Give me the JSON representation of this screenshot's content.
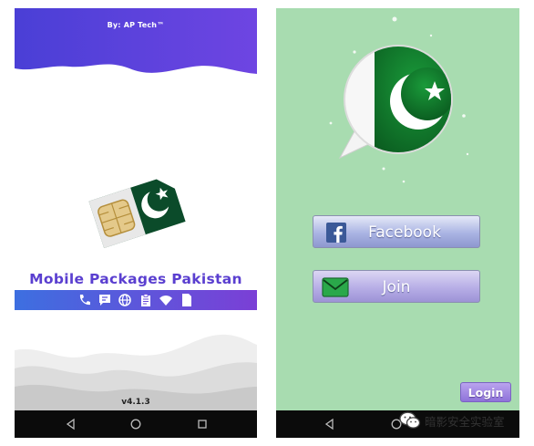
{
  "left_screen": {
    "credit": "By: AP Tech™",
    "app_name": "Mobile Packages Pakistan",
    "version": "v4.1.3",
    "feature_icons": [
      "phone-icon",
      "chat-icon",
      "globe-icon",
      "clipboard-icon",
      "wifi-icon",
      "sim-icon"
    ],
    "colors": {
      "header": "#5f3fdc",
      "strip_start": "#3d6fe0",
      "strip_end": "#7b3fd6",
      "flag_green": "#0b4b2a"
    }
  },
  "right_screen": {
    "facebook_button": "Facebook",
    "join_button": "Join",
    "login_button": "Login",
    "colors": {
      "background": "#a8dcb0",
      "flag_green": "#0d6b27",
      "facebook_blue": "#3b5998"
    }
  },
  "watermark": {
    "text": "暗影安全实验室"
  },
  "navigation": [
    "back-icon",
    "home-icon",
    "recents-icon"
  ]
}
